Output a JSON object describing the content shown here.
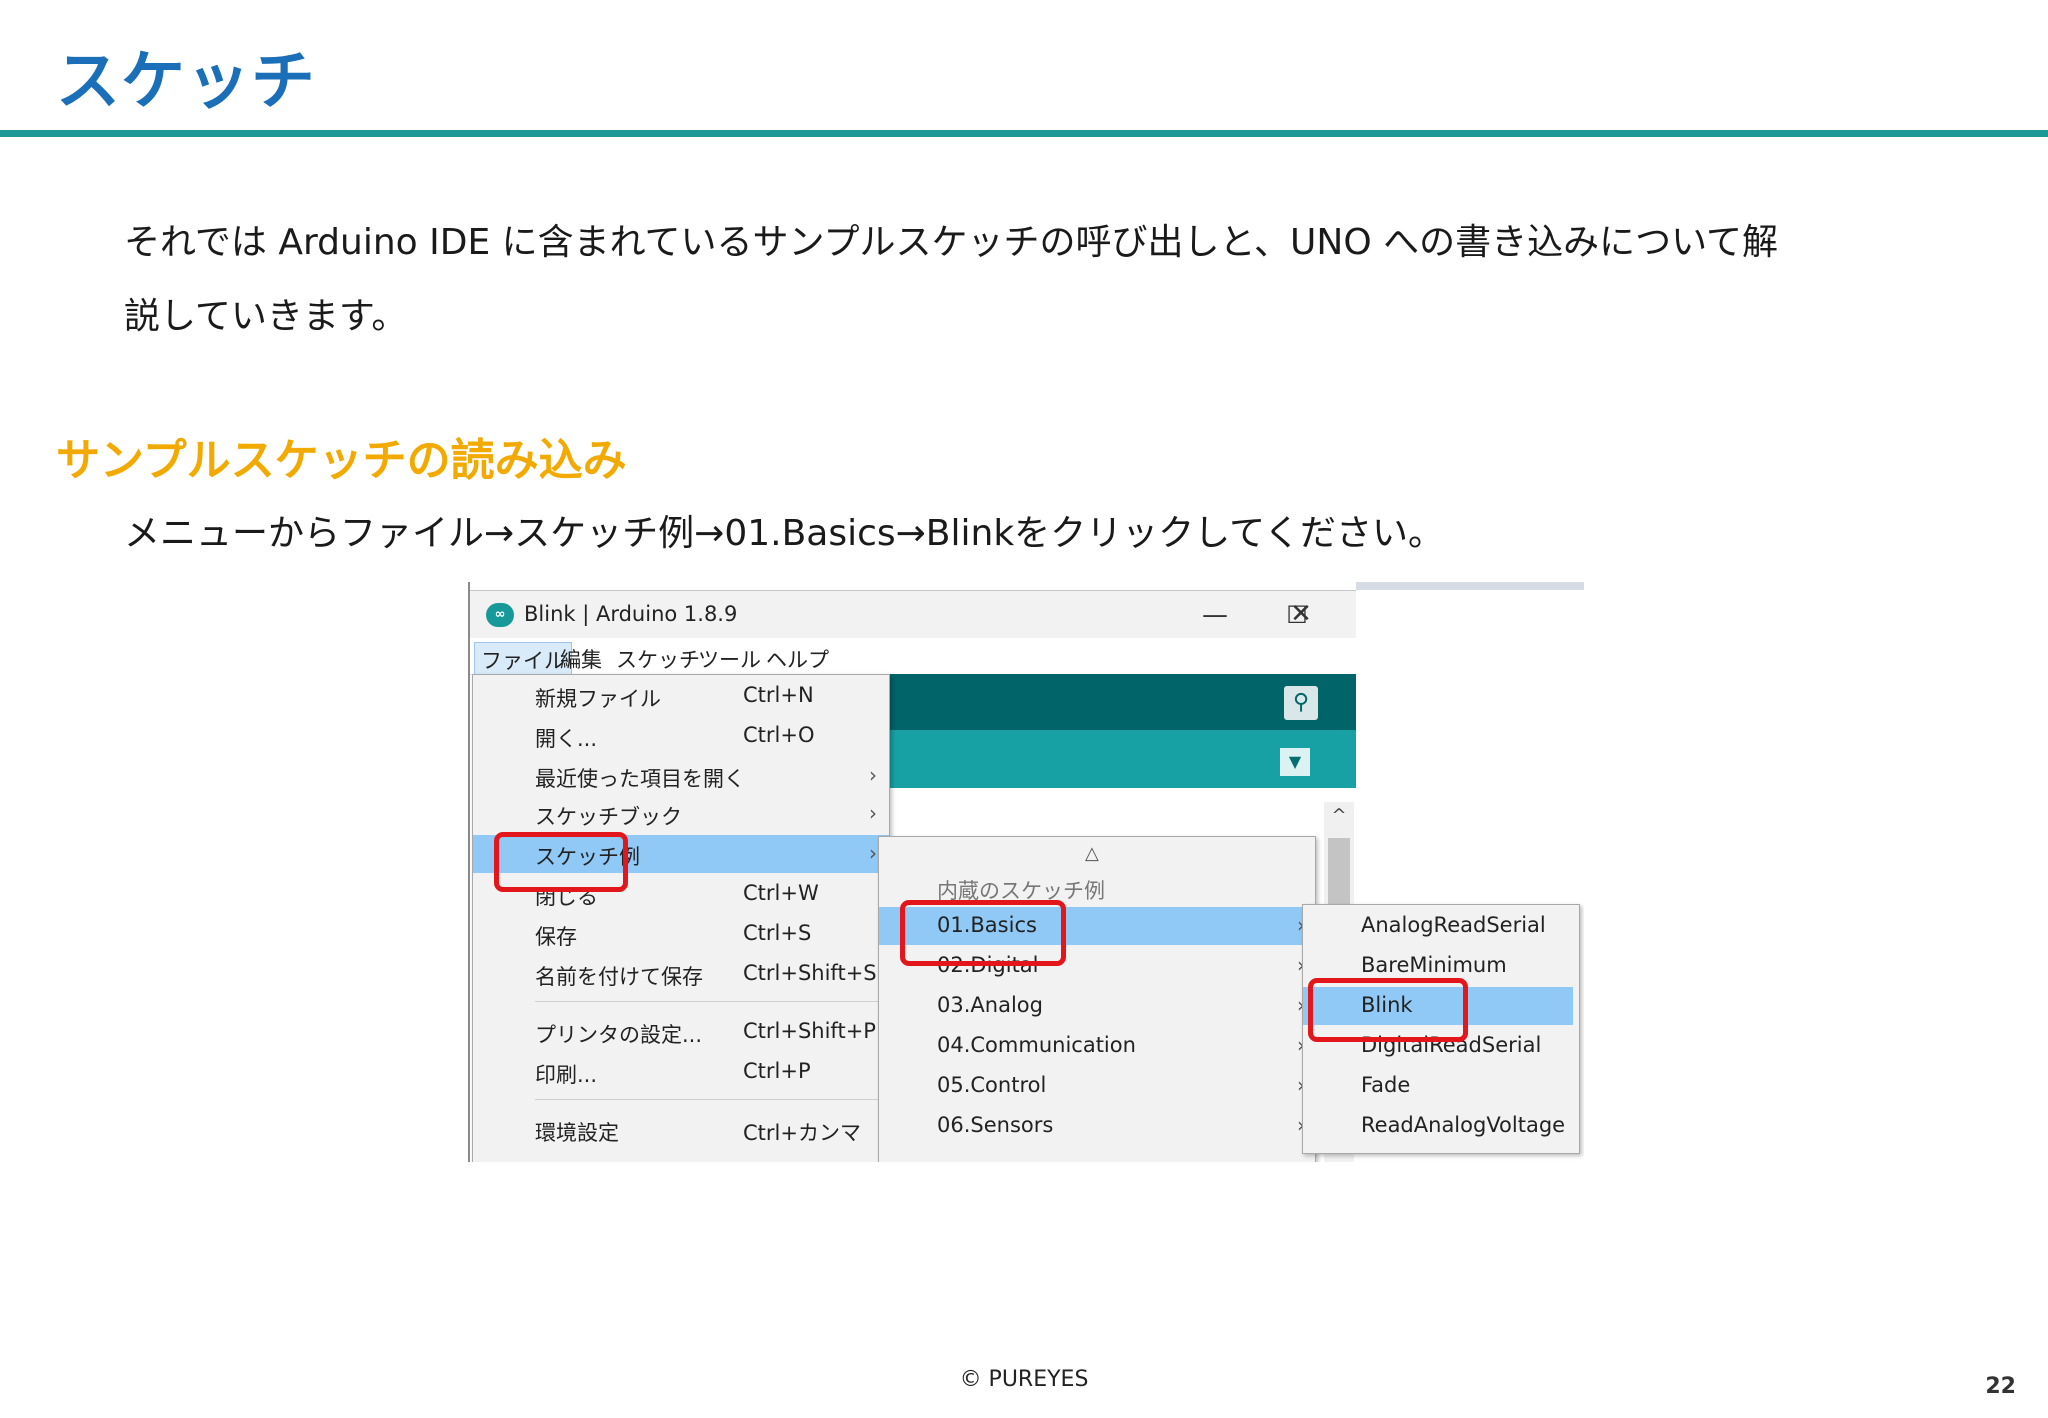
{
  "slide": {
    "title": "スケッチ",
    "intro_line1": "それでは Arduino IDE に含まれているサンプルスケッチの呼び出しと、UNO への書き込みについて解",
    "intro_line2": "説していきます。",
    "section_heading": "サンプルスケッチの読み込み",
    "instruction": "メニューからファイル→スケッチ例→01.Basics→Blinkをクリックしてください。",
    "copyright": "© PUREYES",
    "page_number": "22"
  },
  "colors": {
    "title": "#1a6fb8",
    "rule": "#1e9a96",
    "section_heading": "#f2a900",
    "callout": "#e3161b",
    "highlight": "#90c8f6",
    "ide_toolbar": "#006468",
    "ide_tabs": "#17a1a5"
  },
  "ide": {
    "window_title": "Blink | Arduino 1.8.9",
    "window_controls": {
      "minimize": "—",
      "maximize": "☐",
      "close": "✕"
    },
    "menubar": [
      "ファイル",
      "編集",
      "スケッチ",
      "ツール",
      "ヘルプ"
    ],
    "active_menu": "ファイル",
    "file_menu": [
      {
        "label": "新規ファイル",
        "shortcut": "Ctrl+N",
        "submenu": false
      },
      {
        "label": "開く...",
        "shortcut": "Ctrl+O",
        "submenu": false
      },
      {
        "label": "最近使った項目を開く",
        "shortcut": "",
        "submenu": true
      },
      {
        "label": "スケッチブック",
        "shortcut": "",
        "submenu": true
      },
      {
        "label": "スケッチ例",
        "shortcut": "",
        "submenu": true,
        "highlighted": true
      },
      {
        "label": "閉じる",
        "shortcut": "Ctrl+W",
        "submenu": false
      },
      {
        "label": "保存",
        "shortcut": "Ctrl+S",
        "submenu": false
      },
      {
        "label": "名前を付けて保存",
        "shortcut": "Ctrl+Shift+S",
        "submenu": false
      },
      {
        "label": "プリンタの設定...",
        "shortcut": "Ctrl+Shift+P",
        "submenu": false
      },
      {
        "label": "印刷...",
        "shortcut": "Ctrl+P",
        "submenu": false
      },
      {
        "label": "環境設定",
        "shortcut": "Ctrl+カンマ",
        "submenu": false
      }
    ],
    "examples_menu": {
      "scroll_up": "△",
      "header": "内蔵のスケッチ例",
      "items": [
        {
          "label": "01.Basics",
          "highlighted": true
        },
        {
          "label": "02.Digital"
        },
        {
          "label": "03.Analog"
        },
        {
          "label": "04.Communication"
        },
        {
          "label": "05.Control"
        },
        {
          "label": "06.Sensors"
        }
      ]
    },
    "basics_menu": [
      {
        "label": "AnalogReadSerial"
      },
      {
        "label": "BareMinimum"
      },
      {
        "label": "Blink",
        "highlighted": true
      },
      {
        "label": "DigitalReadSerial"
      },
      {
        "label": "Fade"
      },
      {
        "label": "ReadAnalogVoltage"
      }
    ],
    "icons": {
      "app": "arduino-logo-icon",
      "serial_monitor": "magnifier-icon",
      "tab_menu": "triangle-down-icon",
      "submenu": "chevron-right-icon"
    }
  }
}
